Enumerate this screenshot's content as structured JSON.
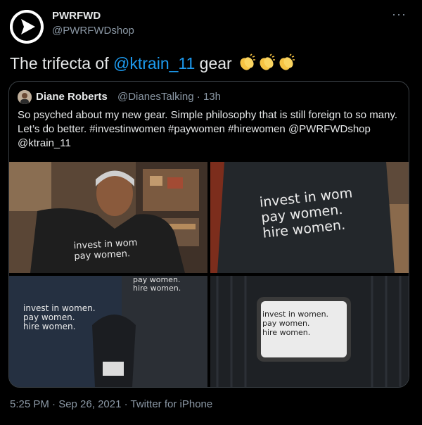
{
  "author": {
    "name": "PWRFWD",
    "handle": "@PWRFWDshop",
    "avatar_icon": "pwrfwd-arrow-logo",
    "more_label": "···"
  },
  "tweet": {
    "text_before": "The trifecta of ",
    "mention": "@ktrain_11",
    "text_after": " gear",
    "emojis": [
      "clapping-hands",
      "clapping-hands",
      "clapping-hands"
    ]
  },
  "quoted": {
    "name": "Diane Roberts",
    "meta": "@DianesTalking · 13h",
    "text": "So psyched about my new gear. Simple philosophy that is still foreign to so many. Let’s do better. #investinwomen #paywomen #hirewomen @PWRFWDshop @ktrain_11",
    "photos": [
      {
        "shirt_text": [
          "invest in wom",
          "pay women."
        ]
      },
      {
        "shirt_text": [
          "invest in wom",
          "pay women.",
          "hire women."
        ]
      },
      {
        "shirt_text": [
          "invest in women.",
          "pay women.",
          "hire women."
        ],
        "back_text": [
          "pay women.",
          "hire women."
        ]
      },
      {
        "patch_text": [
          "invest in women.",
          "pay women.",
          "hire women."
        ]
      }
    ]
  },
  "footer": {
    "timestamp": "5:25 PM · Sep 26, 2021 · Twitter for iPhone"
  },
  "colors": {
    "background": "#000000",
    "text": "#e7e9ea",
    "muted": "#8b98a5",
    "link": "#1d9bf0",
    "border": "#3a4045"
  }
}
